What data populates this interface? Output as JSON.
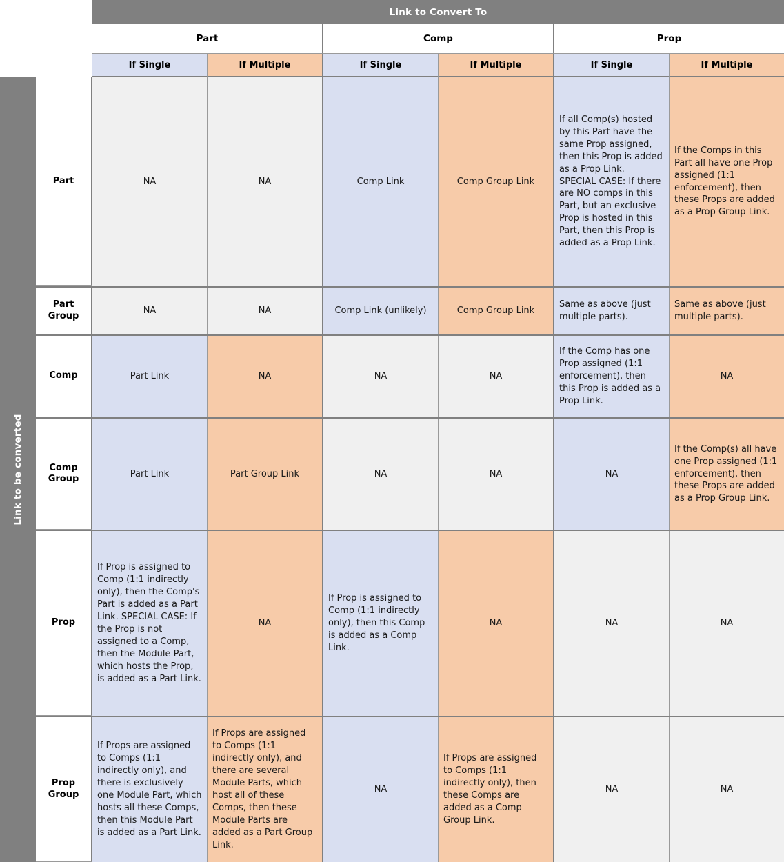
{
  "banners": {
    "top": "Link to Convert To",
    "left": "Link to be converted"
  },
  "column_groups": [
    {
      "label": "Part"
    },
    {
      "label": "Comp"
    },
    {
      "label": "Prop"
    }
  ],
  "sub_headers": [
    {
      "label": "If Single",
      "variant": "blue"
    },
    {
      "label": "If Multiple",
      "variant": "orange"
    },
    {
      "label": "If Single",
      "variant": "blue"
    },
    {
      "label": "If Multiple",
      "variant": "orange"
    },
    {
      "label": "If Single",
      "variant": "blue"
    },
    {
      "label": "If Multiple",
      "variant": "orange"
    }
  ],
  "rows": [
    {
      "header": "Part",
      "cells": [
        {
          "text": "NA",
          "variant": "grey",
          "align": "center"
        },
        {
          "text": "NA",
          "variant": "grey",
          "align": "center"
        },
        {
          "text": "Comp Link",
          "variant": "blue",
          "align": "center"
        },
        {
          "text": "Comp Group Link",
          "variant": "orange",
          "align": "center"
        },
        {
          "text": "If all Comp(s) hosted by this Part have the same Prop assigned, then this Prop is added as a Prop Link. SPECIAL CASE: If there are NO comps in this Part, but an exclusive Prop is hosted in this Part, then this Prop is added as a Prop Link.",
          "variant": "blue",
          "align": "left"
        },
        {
          "text": "If the Comps in this Part all have one Prop assigned (1:1 enforcement), then these Props are added as a Prop Group Link.",
          "variant": "orange",
          "align": "left"
        }
      ]
    },
    {
      "header": "Part Group",
      "cells": [
        {
          "text": "NA",
          "variant": "grey",
          "align": "center"
        },
        {
          "text": "NA",
          "variant": "grey",
          "align": "center"
        },
        {
          "text": "Comp Link (unlikely)",
          "variant": "blue",
          "align": "center"
        },
        {
          "text": "Comp Group Link",
          "variant": "orange",
          "align": "center"
        },
        {
          "text": "Same as above (just multiple parts).",
          "variant": "blue",
          "align": "left"
        },
        {
          "text": "Same as above (just multiple parts).",
          "variant": "orange",
          "align": "left"
        }
      ]
    },
    {
      "header": "Comp",
      "cells": [
        {
          "text": "Part Link",
          "variant": "blue",
          "align": "center"
        },
        {
          "text": "NA",
          "variant": "orange",
          "align": "center"
        },
        {
          "text": "NA",
          "variant": "grey",
          "align": "center"
        },
        {
          "text": "NA",
          "variant": "grey",
          "align": "center"
        },
        {
          "text": "If the Comp has one Prop assigned (1:1 enforcement), then this Prop is added as a Prop Link.",
          "variant": "blue",
          "align": "left"
        },
        {
          "text": "NA",
          "variant": "orange",
          "align": "center"
        }
      ]
    },
    {
      "header": "Comp Group",
      "cells": [
        {
          "text": "Part Link",
          "variant": "blue",
          "align": "center"
        },
        {
          "text": "Part Group Link",
          "variant": "orange",
          "align": "center"
        },
        {
          "text": "NA",
          "variant": "grey",
          "align": "center"
        },
        {
          "text": "NA",
          "variant": "grey",
          "align": "center"
        },
        {
          "text": "NA",
          "variant": "blue",
          "align": "center"
        },
        {
          "text": "If the Comp(s) all have one Prop assigned (1:1 enforcement), then these Props are added as a Prop Group Link.",
          "variant": "orange",
          "align": "left"
        }
      ]
    },
    {
      "header": "Prop",
      "cells": [
        {
          "text": "If Prop is assigned to Comp (1:1 indirectly only), then the Comp's Part is added as a Part Link. SPECIAL CASE: If the Prop is not assigned to a Comp, then the Module Part, which hosts the Prop, is added as a Part Link.",
          "variant": "blue",
          "align": "left"
        },
        {
          "text": "NA",
          "variant": "orange",
          "align": "center"
        },
        {
          "text": "If Prop is assigned to Comp (1:1 indirectly only), then this Comp is added as a Comp Link.",
          "variant": "blue",
          "align": "left"
        },
        {
          "text": "NA",
          "variant": "orange",
          "align": "center"
        },
        {
          "text": "NA",
          "variant": "grey",
          "align": "center"
        },
        {
          "text": "NA",
          "variant": "grey",
          "align": "center"
        }
      ]
    },
    {
      "header": "Prop Group",
      "cells": [
        {
          "text": "If Props are assigned to Comps (1:1 indirectly only), and there is exclusively one Module Part, which hosts all these Comps, then this Module Part is added as a Part Link.",
          "variant": "blue",
          "align": "left"
        },
        {
          "text": "If Props are assigned to Comps (1:1 indirectly only), and there are several Module Parts, which host all of these Comps, then these Module Parts are added as a Part Group Link.",
          "variant": "orange",
          "align": "left"
        },
        {
          "text": "NA",
          "variant": "blue",
          "align": "center"
        },
        {
          "text": "If Props are assigned to Comps (1:1 indirectly only), then these Comps are added as a Comp Group Link.",
          "variant": "orange",
          "align": "left"
        },
        {
          "text": "NA",
          "variant": "grey",
          "align": "center"
        },
        {
          "text": "NA",
          "variant": "grey",
          "align": "center"
        }
      ]
    }
  ],
  "colors": {
    "banner_grey": "#808080",
    "single_blue": "#d9dff1",
    "multiple_orange": "#f7cba9",
    "na_grey": "#f0f0f0",
    "border_grey": "#9a9a9a"
  }
}
